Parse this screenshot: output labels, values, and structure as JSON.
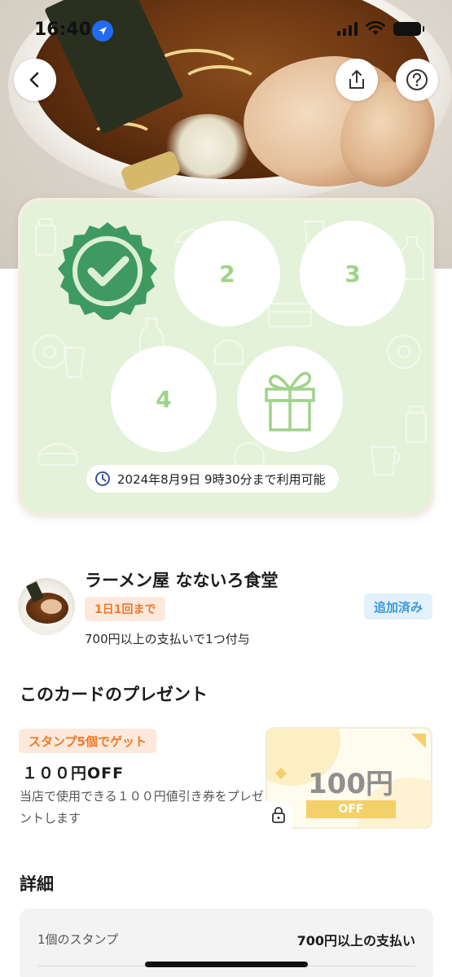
{
  "status_bar": {
    "time": "16:40"
  },
  "nav": {
    "back_icon": "chevron-left-icon",
    "share_icon": "share-icon",
    "help_icon": "question-icon"
  },
  "stamp_card": {
    "stamps": [
      {
        "label": "",
        "state": "stamped"
      },
      {
        "label": "2",
        "state": "empty"
      },
      {
        "label": "3",
        "state": "empty"
      },
      {
        "label": "4",
        "state": "empty"
      },
      {
        "label": "",
        "state": "gift"
      }
    ],
    "expiry": "2024年8月9日 9時30分まで利用可能",
    "colors": {
      "card_bg": "#e3f2d8",
      "stamp_green": "#3f9a62",
      "number_green": "#9fd38a"
    }
  },
  "shop": {
    "name": "ラーメン屋 なないろ食堂",
    "limit_badge": "1日1回まで",
    "added_badge": "追加済み",
    "condition": "700円以上の支払いで1つ付与"
  },
  "present": {
    "section_title": "このカードのプレゼント",
    "badge": "スタンプ5個でゲット",
    "title": "１００円OFF",
    "description": "当店で使用できる１００円値引き券をプレゼントします",
    "coupon_amount": "100円",
    "coupon_ribbon": "OFF"
  },
  "details": {
    "section_title": "詳細",
    "rows": [
      {
        "label": "1個のスタンプ",
        "value": "700円以上の支払い"
      }
    ]
  }
}
